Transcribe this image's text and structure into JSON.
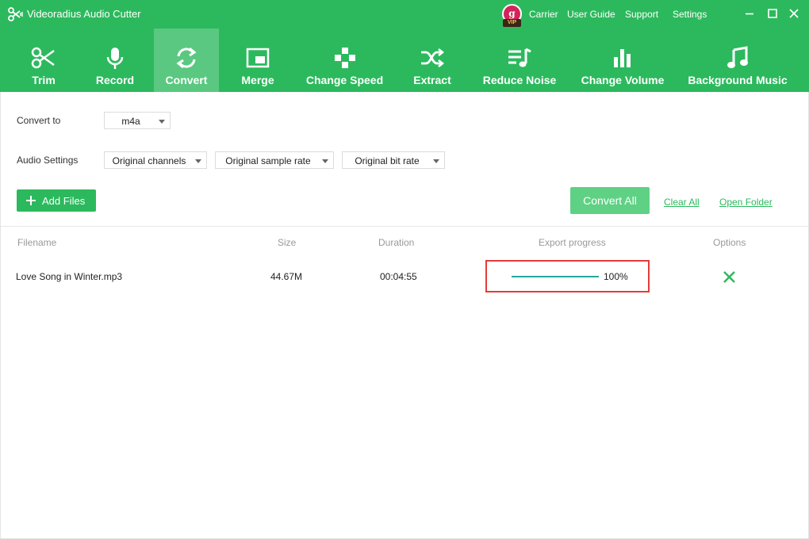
{
  "window": {
    "title": "Videoradius Audio Cutter",
    "links": [
      "Carrier",
      "User Guide",
      "Support",
      "Settings"
    ],
    "vip": {
      "letter": "g",
      "tag": "VIP"
    },
    "accent_color": "#2cb95d"
  },
  "toolbar": {
    "items": [
      {
        "label": "Trim",
        "icon": "scissors-icon"
      },
      {
        "label": "Record",
        "icon": "microphone-icon"
      },
      {
        "label": "Convert",
        "icon": "convert-arrows-icon",
        "active": true
      },
      {
        "label": "Merge",
        "icon": "merge-icon"
      },
      {
        "label": "Change Speed",
        "icon": "gamepad-icon"
      },
      {
        "label": "Extract",
        "icon": "shuffle-icon"
      },
      {
        "label": "Reduce Noise",
        "icon": "music-list-icon"
      },
      {
        "label": "Change Volume",
        "icon": "bar-chart-icon"
      },
      {
        "label": "Background Music",
        "icon": "music-note-icon"
      }
    ]
  },
  "settings": {
    "convert_to_label": "Convert to",
    "format": "m4a",
    "audio_settings_label": "Audio Settings",
    "channels": "Original channels",
    "sample_rate": "Original sample rate",
    "bit_rate": "Original bit rate"
  },
  "actions": {
    "add_files": "Add Files",
    "convert_all": "Convert All",
    "clear_all": "Clear All",
    "open_folder": "Open Folder"
  },
  "table": {
    "headers": [
      "Filename",
      "Size",
      "Duration",
      "Export progress",
      "Options"
    ],
    "rows": [
      {
        "filename": "Love Song in Winter.mp3",
        "size": "44.67M",
        "duration": "00:04:55",
        "progress": 100,
        "progress_text": "100%"
      }
    ]
  }
}
